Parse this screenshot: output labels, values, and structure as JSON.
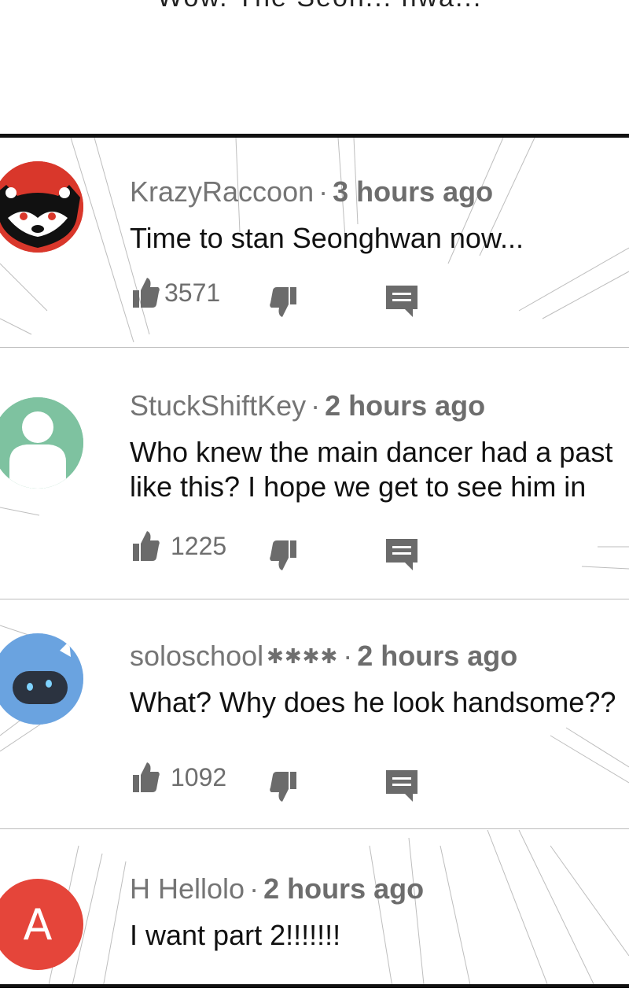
{
  "top_text": "Wow. The Seon... hwa...",
  "comments": [
    {
      "username": "KrazyRaccoon",
      "separator": "·",
      "time": "3 hours ago",
      "text_lines": [
        "Time to stan Seonghwan now..."
      ],
      "likes": "3571",
      "avatar": {
        "type": "raccoon",
        "bg": "#d9372b"
      }
    },
    {
      "username": "StuckShiftKey",
      "separator": "·",
      "time": "2 hours ago",
      "text_lines": [
        "Who knew the main dancer had a past",
        "like this? I hope we get to see him in"
      ],
      "likes": "1225",
      "avatar": {
        "type": "silhouette",
        "bg": "#7ec2a0"
      }
    },
    {
      "username": "soloschool",
      "badge": "✱✱✱✱",
      "separator": "·",
      "time": "2 hours ago",
      "text_lines": [
        "What? Why does he look handsome??"
      ],
      "likes": "1092",
      "avatar": {
        "type": "robot",
        "bg": "#6aa3e0"
      }
    },
    {
      "username": "H Hellolo",
      "separator": "·",
      "time": "2 hours ago",
      "text_lines": [
        "I want part 2!!!!!!!"
      ],
      "avatar": {
        "type": "letter",
        "letter": "A",
        "bg": "#e5453a"
      }
    }
  ],
  "icons": {
    "like": "thumbs-up-icon",
    "dislike": "thumbs-down-icon",
    "reply": "reply-icon"
  },
  "colors": {
    "icon": "#6b6b6b",
    "divider": "#bdbdbd",
    "border": "#111111"
  }
}
